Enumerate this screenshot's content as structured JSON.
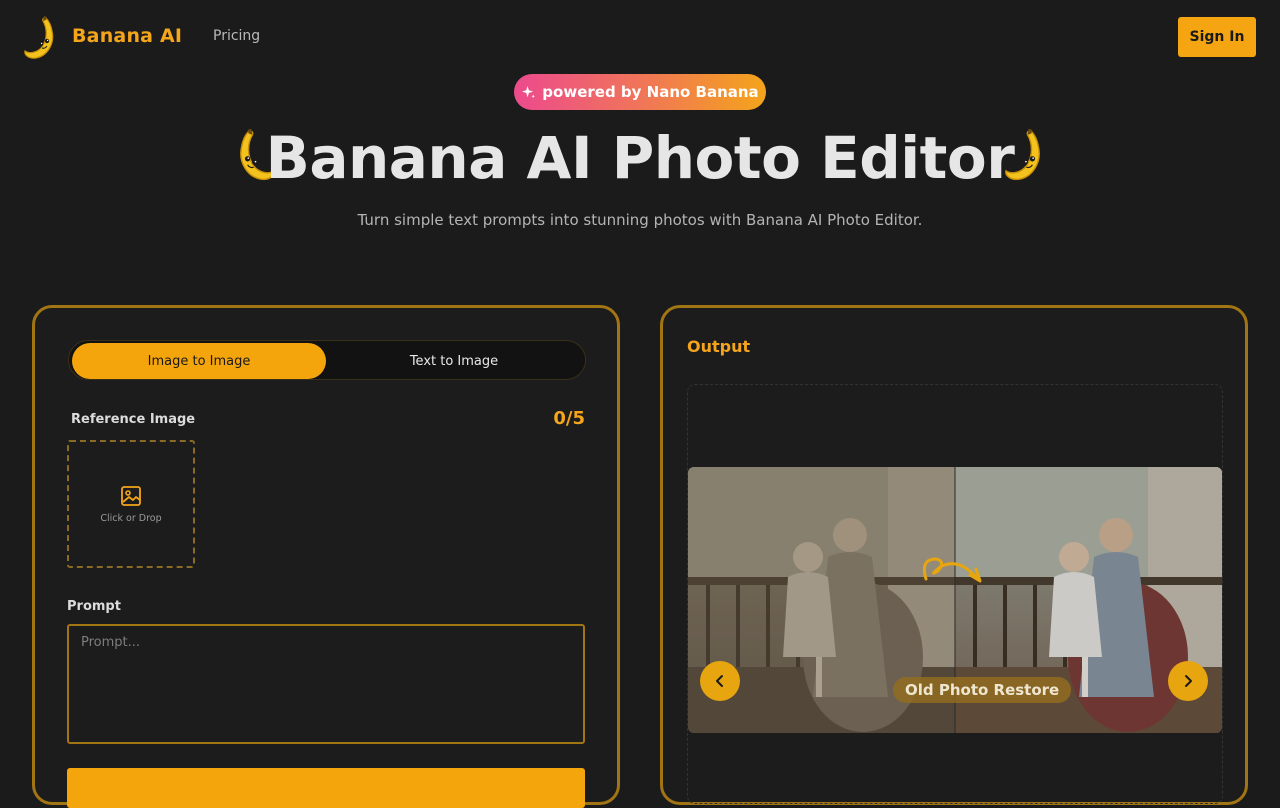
{
  "header": {
    "brand": "Banana AI",
    "nav_pricing": "Pricing",
    "signin_label": "Sign In"
  },
  "hero": {
    "badge": "powered by Nano Banana",
    "title": "Banana AI Photo Editor",
    "subtitle": "Turn simple text prompts into stunning photos with Banana AI Photo Editor."
  },
  "editor": {
    "tabs": [
      {
        "label": "Image to Image",
        "active": true
      },
      {
        "label": "Text to Image",
        "active": false
      }
    ],
    "reference_label": "Reference Image",
    "reference_count": "0/5",
    "dropzone_text": "Click or Drop",
    "prompt_label": "Prompt",
    "prompt_placeholder": "Prompt..."
  },
  "output": {
    "title": "Output",
    "caption": "Old Photo Restore"
  },
  "colors": {
    "accent": "#f5a50c",
    "brand_text": "#f4a51c",
    "panel_border": "#a17414",
    "background": "#1b1b1b"
  }
}
